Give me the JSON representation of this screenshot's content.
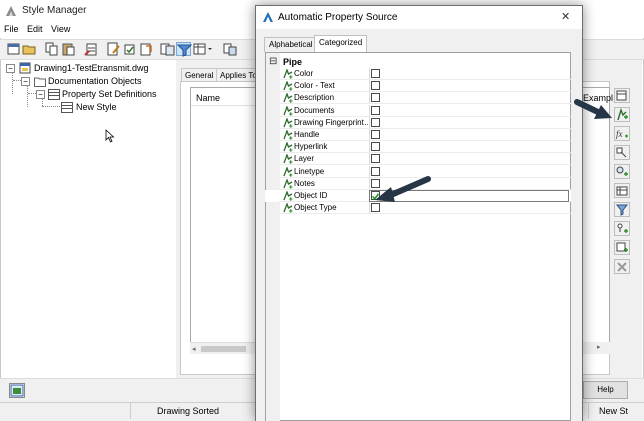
{
  "window": {
    "title": "Style Manager",
    "menu": [
      "File",
      "Edit",
      "View"
    ]
  },
  "tree": {
    "root": "Drawing1-TestEtransmit.dwg",
    "documentation_objects": "Documentation Objects",
    "property_set_definitions": "Property Set Definitions",
    "new_style": "New Style"
  },
  "tabs": {
    "general": "General",
    "applies_to": "Applies To"
  },
  "list": {
    "name_header": "Name",
    "example_header": "Exampl"
  },
  "buttons": {
    "help": "Help"
  },
  "status": {
    "drawing_sorted": "Drawing Sorted",
    "new_style": "New St"
  },
  "dialog": {
    "title": "Automatic Property Source",
    "close_glyph": "✕",
    "tabs": [
      "Alphabetical",
      "Categorized"
    ],
    "active_tab": "Categorized",
    "category": "Pipe",
    "collapse_glyph": "⊟",
    "properties": [
      {
        "name": "Color",
        "checked": false
      },
      {
        "name": "Color - Text",
        "checked": false
      },
      {
        "name": "Description",
        "checked": false
      },
      {
        "name": "Documents",
        "checked": false
      },
      {
        "name": "Drawing Fingerprint…",
        "checked": false
      },
      {
        "name": "Handle",
        "checked": false
      },
      {
        "name": "Hyperlink",
        "checked": false
      },
      {
        "name": "Layer",
        "checked": false
      },
      {
        "name": "Linetype",
        "checked": false
      },
      {
        "name": "Notes",
        "checked": false
      },
      {
        "name": "Object ID",
        "checked": true
      },
      {
        "name": "Object Type",
        "checked": false
      }
    ]
  },
  "colors": {
    "check_green": "#1a8f1a",
    "arrow": "#263647",
    "dialog_border": "#6d6d6d"
  }
}
